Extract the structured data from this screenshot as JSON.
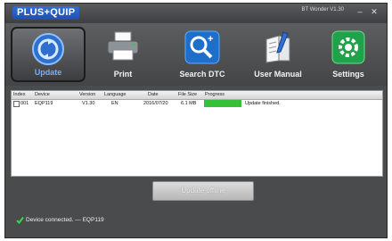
{
  "app": {
    "logo": "PLUS+QUIP",
    "version": "BT Wonder V1.30",
    "window_controls": [
      "–",
      "✕"
    ]
  },
  "toolbar": {
    "items": [
      {
        "label": "Update",
        "icon": "update-globe-icon",
        "active": true
      },
      {
        "label": "Print",
        "icon": "printer-icon",
        "active": false
      },
      {
        "label": "Search DTC",
        "icon": "search-dtc-icon",
        "active": false
      },
      {
        "label": "User Manual",
        "icon": "user-manual-icon",
        "active": false
      },
      {
        "label": "Settings",
        "icon": "gear-icon",
        "active": false
      }
    ]
  },
  "table": {
    "headers": [
      "Index",
      "Device",
      "Version",
      "Language",
      "Date",
      "File Size",
      "Progress"
    ],
    "rows": [
      {
        "index": "001",
        "device": "EQP119",
        "version": "V1.30",
        "language": "EN",
        "date": "2016/07/20",
        "file_size": "6.1 MB",
        "progress": 1.0,
        "status": "Update finished."
      }
    ]
  },
  "actions": {
    "update_offline": "Update offline"
  },
  "status_bar": {
    "text": "Device connected. — EQP119",
    "icon": "check-icon"
  },
  "colors": {
    "progress_fill": "#34c038",
    "active_label": "#6fb0ff",
    "logo_blue": "#2f6fd6"
  }
}
